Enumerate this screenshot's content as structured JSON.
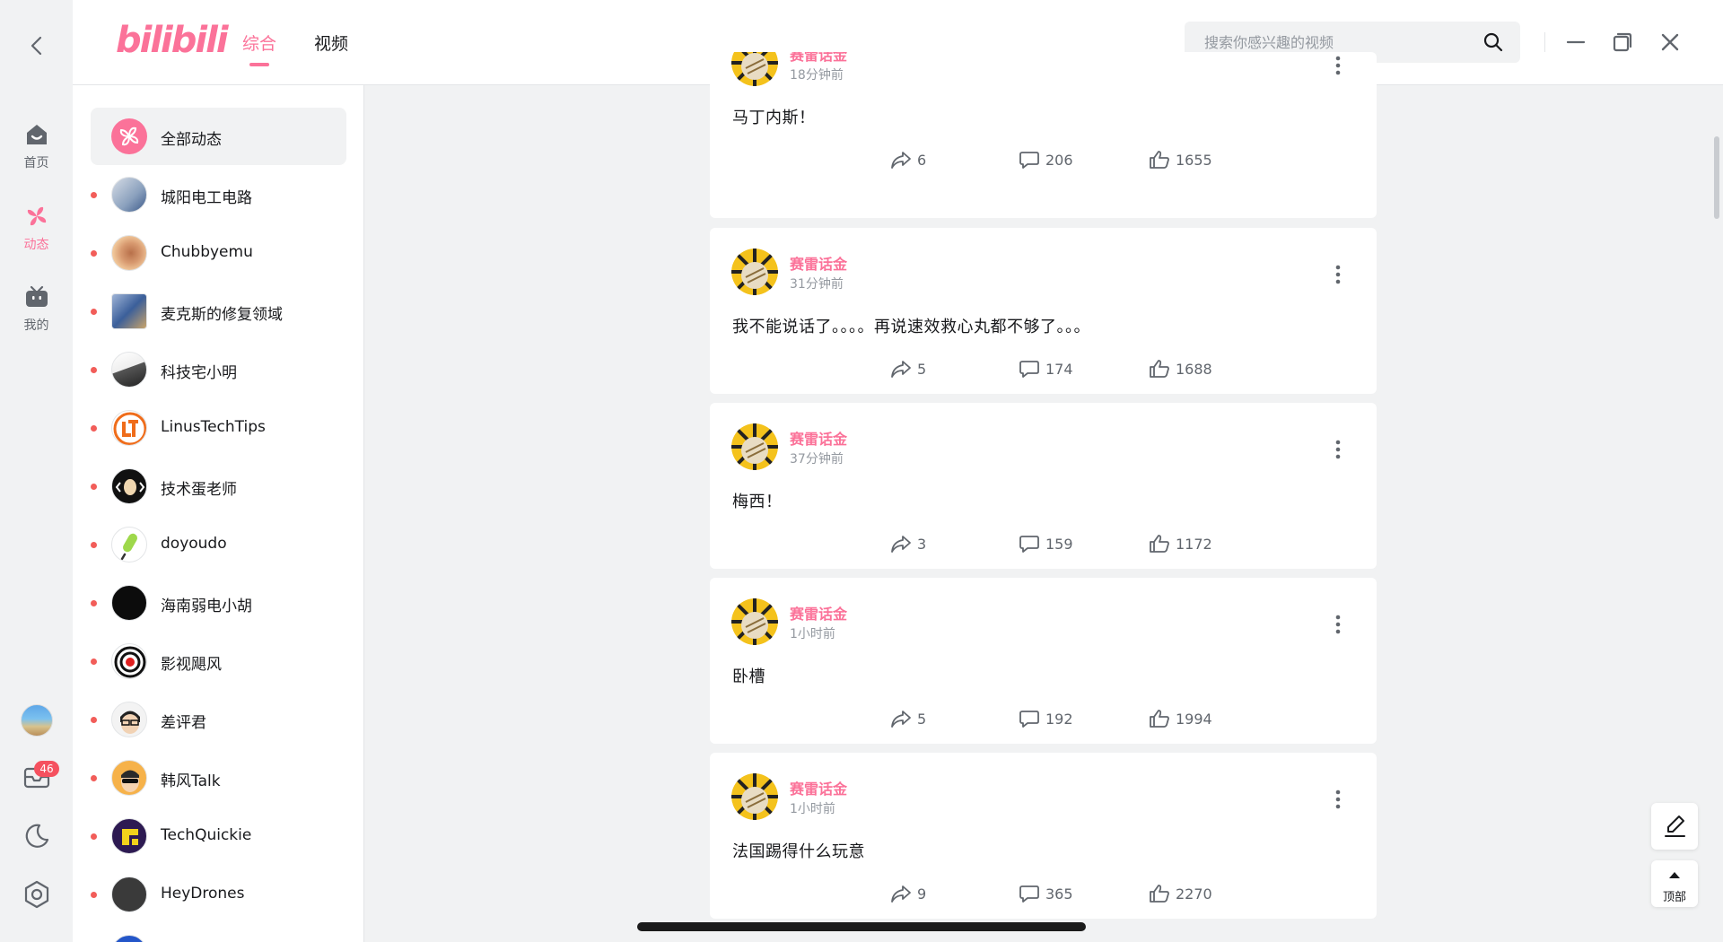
{
  "app": {
    "logo_text": "bilibili",
    "accent_color": "#fb7299"
  },
  "left_rail": {
    "items": [
      {
        "label": "首页",
        "icon": "home-icon"
      },
      {
        "label": "动态",
        "icon": "pinwheel-icon",
        "active": true
      },
      {
        "label": "我的",
        "icon": "tv-icon"
      }
    ],
    "bottom": {
      "avatar": "user-avatar",
      "messages_badge": "46"
    }
  },
  "top_bar": {
    "tabs": [
      {
        "label": "综合",
        "active": true
      },
      {
        "label": "视频"
      }
    ],
    "search": {
      "placeholder": "搜索你感兴趣的视频",
      "value": ""
    }
  },
  "sidebar": {
    "items": [
      {
        "label": "全部动态",
        "selected": true
      },
      {
        "label": "城阳电工电路"
      },
      {
        "label": "Chubbyemu"
      },
      {
        "label": "麦克斯的修复领域"
      },
      {
        "label": "科技宅小明"
      },
      {
        "label": "LinusTechTips"
      },
      {
        "label": "技术蛋老师"
      },
      {
        "label": "doyoudo"
      },
      {
        "label": "海南弱电小胡"
      },
      {
        "label": "影视飓风"
      },
      {
        "label": "差评君"
      },
      {
        "label": "韩风Talk"
      },
      {
        "label": "TechQuickie"
      },
      {
        "label": "HeyDrones"
      }
    ]
  },
  "feed": {
    "posts": [
      {
        "author": "赛雷话金",
        "time": "18分钟前",
        "text": "马丁内斯！",
        "shares": "6",
        "comments": "206",
        "likes": "1655"
      },
      {
        "author": "赛雷话金",
        "time": "31分钟前",
        "text": "我不能说话了。。。。再说速效救心丸都不够了。。。",
        "shares": "5",
        "comments": "174",
        "likes": "1688"
      },
      {
        "author": "赛雷话金",
        "time": "37分钟前",
        "text": "梅西！",
        "shares": "3",
        "comments": "159",
        "likes": "1172"
      },
      {
        "author": "赛雷话金",
        "time": "1小时前",
        "text": "卧槽",
        "shares": "5",
        "comments": "192",
        "likes": "1994"
      },
      {
        "author": "赛雷话金",
        "time": "1小时前",
        "text": "法国踢得什么玩意",
        "shares": "9",
        "comments": "365",
        "likes": "2270"
      }
    ]
  },
  "floating": {
    "top_label": "顶部"
  }
}
